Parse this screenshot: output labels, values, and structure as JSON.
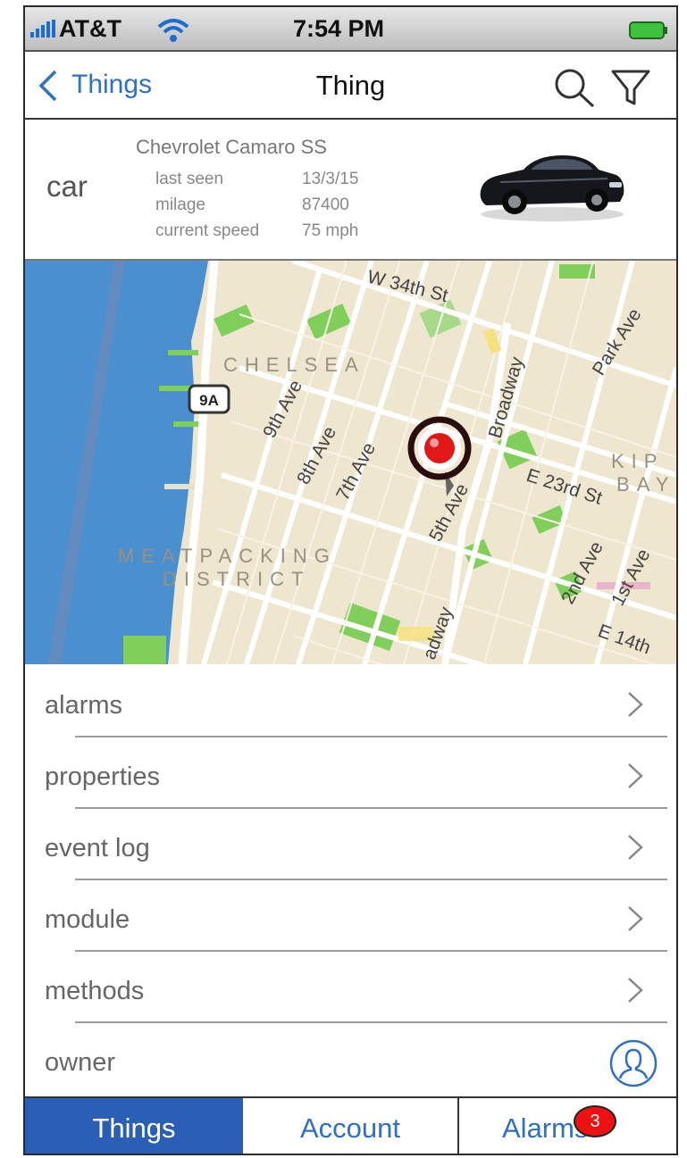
{
  "status_bar": {
    "carrier": "AT&T",
    "time": "7:54 PM"
  },
  "nav": {
    "back_label": "Things",
    "title": "Thing"
  },
  "thing": {
    "type": "car",
    "name": "Chevrolet Camaro SS",
    "specs": [
      {
        "label": "last seen",
        "value": "13/3/15"
      },
      {
        "label": "milage",
        "value": "87400"
      },
      {
        "label": "current speed",
        "value": "75 mph"
      }
    ]
  },
  "map": {
    "streets": [
      "W 34th St",
      "Park Ave",
      "Broadway",
      "9th Ave",
      "8th Ave",
      "7th Ave",
      "5th Ave",
      "E 23rd St",
      "2nd Ave",
      "1st Ave",
      "E 14th",
      "adway"
    ],
    "districts": [
      "CHELSEA",
      "MEATPACKING",
      "DISTRICT",
      "KIP",
      "BAY"
    ],
    "route_shield": "9A"
  },
  "menu": {
    "items": [
      {
        "label": "alarms"
      },
      {
        "label": "properties"
      },
      {
        "label": "event log"
      },
      {
        "label": "module"
      },
      {
        "label": "methods"
      },
      {
        "label": "owner"
      }
    ]
  },
  "tabs": {
    "items": [
      {
        "label": "Things"
      },
      {
        "label": "Account"
      },
      {
        "label": "Alarms"
      }
    ],
    "alarms_badge": "3"
  },
  "colors": {
    "accent": "#2f6fc4",
    "tab_active": "#2b5fb5",
    "badge": "#e11111",
    "map_water": "#4a8fcf",
    "map_park": "#7fcf5a"
  }
}
